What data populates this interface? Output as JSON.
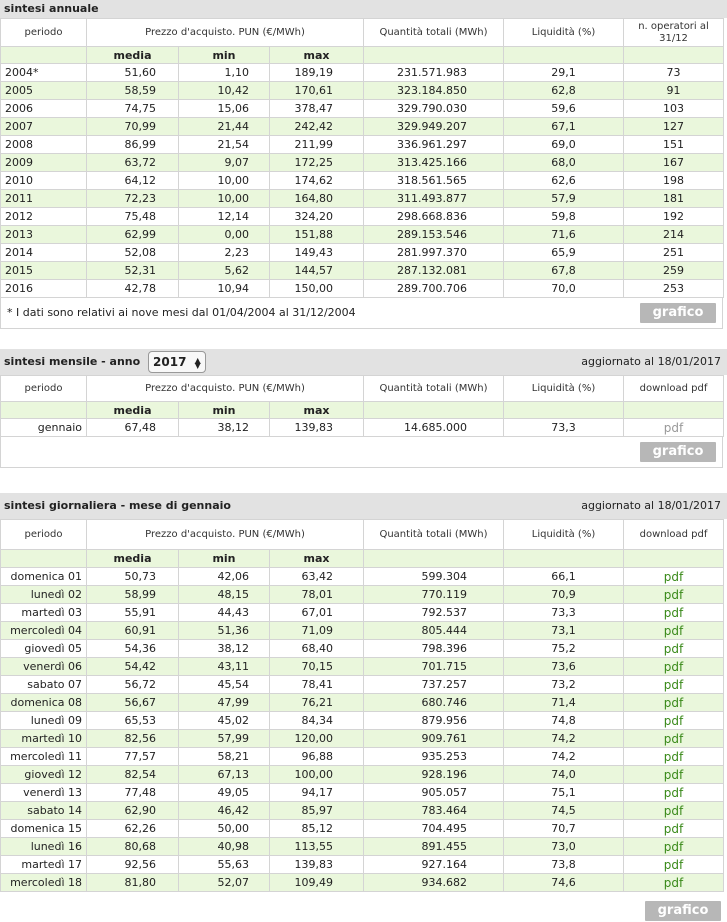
{
  "annual": {
    "title": "sintesi annuale",
    "headers": {
      "periodo": "periodo",
      "prezzo": "Prezzo d'acquisto. PUN (€/MWh)",
      "quantita": "Quantità totali (MWh)",
      "liquidita": "Liquidità (%)",
      "operatori": "n. operatori al 31/12",
      "media": "media",
      "min": "min",
      "max": "max"
    },
    "rows": [
      {
        "periodo": "2004*",
        "media": "51,60",
        "min": "1,10",
        "max": "189,19",
        "quantita": "231.571.983",
        "liquidita": "29,1",
        "operatori": "73"
      },
      {
        "periodo": "2005",
        "media": "58,59",
        "min": "10,42",
        "max": "170,61",
        "quantita": "323.184.850",
        "liquidita": "62,8",
        "operatori": "91"
      },
      {
        "periodo": "2006",
        "media": "74,75",
        "min": "15,06",
        "max": "378,47",
        "quantita": "329.790.030",
        "liquidita": "59,6",
        "operatori": "103"
      },
      {
        "periodo": "2007",
        "media": "70,99",
        "min": "21,44",
        "max": "242,42",
        "quantita": "329.949.207",
        "liquidita": "67,1",
        "operatori": "127"
      },
      {
        "periodo": "2008",
        "media": "86,99",
        "min": "21,54",
        "max": "211,99",
        "quantita": "336.961.297",
        "liquidita": "69,0",
        "operatori": "151"
      },
      {
        "periodo": "2009",
        "media": "63,72",
        "min": "9,07",
        "max": "172,25",
        "quantita": "313.425.166",
        "liquidita": "68,0",
        "operatori": "167"
      },
      {
        "periodo": "2010",
        "media": "64,12",
        "min": "10,00",
        "max": "174,62",
        "quantita": "318.561.565",
        "liquidita": "62,6",
        "operatori": "198"
      },
      {
        "periodo": "2011",
        "media": "72,23",
        "min": "10,00",
        "max": "164,80",
        "quantita": "311.493.877",
        "liquidita": "57,9",
        "operatori": "181"
      },
      {
        "periodo": "2012",
        "media": "75,48",
        "min": "12,14",
        "max": "324,20",
        "quantita": "298.668.836",
        "liquidita": "59,8",
        "operatori": "192"
      },
      {
        "periodo": "2013",
        "media": "62,99",
        "min": "0,00",
        "max": "151,88",
        "quantita": "289.153.546",
        "liquidita": "71,6",
        "operatori": "214"
      },
      {
        "periodo": "2014",
        "media": "52,08",
        "min": "2,23",
        "max": "149,43",
        "quantita": "281.997.370",
        "liquidita": "65,9",
        "operatori": "251"
      },
      {
        "periodo": "2015",
        "media": "52,31",
        "min": "5,62",
        "max": "144,57",
        "quantita": "287.132.081",
        "liquidita": "67,8",
        "operatori": "259"
      },
      {
        "periodo": "2016",
        "media": "42,78",
        "min": "10,94",
        "max": "150,00",
        "quantita": "289.700.706",
        "liquidita": "70,0",
        "operatori": "253"
      }
    ],
    "note": "* I dati sono relativi ai nove mesi dal 01/04/2004 al 31/12/2004",
    "grafico": "grafico"
  },
  "monthly": {
    "title": "sintesi mensile - anno",
    "year": "2017",
    "updated": "aggiornato al 18/01/2017",
    "headers": {
      "periodo": "periodo",
      "prezzo": "Prezzo d'acquisto. PUN (€/MWh)",
      "quantita": "Quantità totali (MWh)",
      "liquidita": "Liquidità (%)",
      "download": "download pdf",
      "media": "media",
      "min": "min",
      "max": "max"
    },
    "rows": [
      {
        "periodo": "gennaio",
        "media": "67,48",
        "min": "38,12",
        "max": "139,83",
        "quantita": "14.685.000",
        "liquidita": "73,3",
        "pdf": "pdf"
      }
    ],
    "grafico": "grafico"
  },
  "daily": {
    "title": "sintesi giornaliera - mese di gennaio",
    "updated": "aggiornato al 18/01/2017",
    "headers": {
      "periodo": "periodo",
      "prezzo": "Prezzo d'acquisto. PUN (€/MWh)",
      "quantita": "Quantità totali (MWh)",
      "liquidita": "Liquidità (%)",
      "download": "download pdf",
      "media": "media",
      "min": "min",
      "max": "max"
    },
    "rows": [
      {
        "periodo": "domenica 01",
        "media": "50,73",
        "min": "42,06",
        "max": "63,42",
        "quantita": "599.304",
        "liquidita": "66,1",
        "pdf": "pdf"
      },
      {
        "periodo": "lunedì 02",
        "media": "58,99",
        "min": "48,15",
        "max": "78,01",
        "quantita": "770.119",
        "liquidita": "70,9",
        "pdf": "pdf"
      },
      {
        "periodo": "martedì 03",
        "media": "55,91",
        "min": "44,43",
        "max": "67,01",
        "quantita": "792.537",
        "liquidita": "73,3",
        "pdf": "pdf"
      },
      {
        "periodo": "mercoledì 04",
        "media": "60,91",
        "min": "51,36",
        "max": "71,09",
        "quantita": "805.444",
        "liquidita": "73,1",
        "pdf": "pdf"
      },
      {
        "periodo": "giovedì 05",
        "media": "54,36",
        "min": "38,12",
        "max": "68,40",
        "quantita": "798.396",
        "liquidita": "75,2",
        "pdf": "pdf"
      },
      {
        "periodo": "venerdì 06",
        "media": "54,42",
        "min": "43,11",
        "max": "70,15",
        "quantita": "701.715",
        "liquidita": "73,6",
        "pdf": "pdf"
      },
      {
        "periodo": "sabato 07",
        "media": "56,72",
        "min": "45,54",
        "max": "78,41",
        "quantita": "737.257",
        "liquidita": "73,2",
        "pdf": "pdf"
      },
      {
        "periodo": "domenica 08",
        "media": "56,67",
        "min": "47,99",
        "max": "76,21",
        "quantita": "680.746",
        "liquidita": "71,4",
        "pdf": "pdf"
      },
      {
        "periodo": "lunedì 09",
        "media": "65,53",
        "min": "45,02",
        "max": "84,34",
        "quantita": "879.956",
        "liquidita": "74,8",
        "pdf": "pdf"
      },
      {
        "periodo": "martedì 10",
        "media": "82,56",
        "min": "57,99",
        "max": "120,00",
        "quantita": "909.761",
        "liquidita": "74,2",
        "pdf": "pdf"
      },
      {
        "periodo": "mercoledì 11",
        "media": "77,57",
        "min": "58,21",
        "max": "96,88",
        "quantita": "935.253",
        "liquidita": "74,2",
        "pdf": "pdf"
      },
      {
        "periodo": "giovedì 12",
        "media": "82,54",
        "min": "67,13",
        "max": "100,00",
        "quantita": "928.196",
        "liquidita": "74,0",
        "pdf": "pdf"
      },
      {
        "periodo": "venerdì 13",
        "media": "77,48",
        "min": "49,05",
        "max": "94,17",
        "quantita": "905.057",
        "liquidita": "75,1",
        "pdf": "pdf"
      },
      {
        "periodo": "sabato 14",
        "media": "62,90",
        "min": "46,42",
        "max": "85,97",
        "quantita": "783.464",
        "liquidita": "74,5",
        "pdf": "pdf"
      },
      {
        "periodo": "domenica 15",
        "media": "62,26",
        "min": "50,00",
        "max": "85,12",
        "quantita": "704.495",
        "liquidita": "70,7",
        "pdf": "pdf"
      },
      {
        "periodo": "lunedì 16",
        "media": "80,68",
        "min": "40,98",
        "max": "113,55",
        "quantita": "891.455",
        "liquidita": "73,0",
        "pdf": "pdf"
      },
      {
        "periodo": "martedì 17",
        "media": "92,56",
        "min": "55,63",
        "max": "139,83",
        "quantita": "927.164",
        "liquidita": "73,8",
        "pdf": "pdf"
      },
      {
        "periodo": "mercoledì 18",
        "media": "81,80",
        "min": "52,07",
        "max": "109,49",
        "quantita": "934.682",
        "liquidita": "74,6",
        "pdf": "pdf"
      }
    ],
    "grafico": "grafico"
  },
  "colors": {
    "green_row": "#eaf7dc",
    "header_bg": "#e2e2e2",
    "pdf_link": "#3a8a1a",
    "button_bg": "#b7b7b7"
  }
}
